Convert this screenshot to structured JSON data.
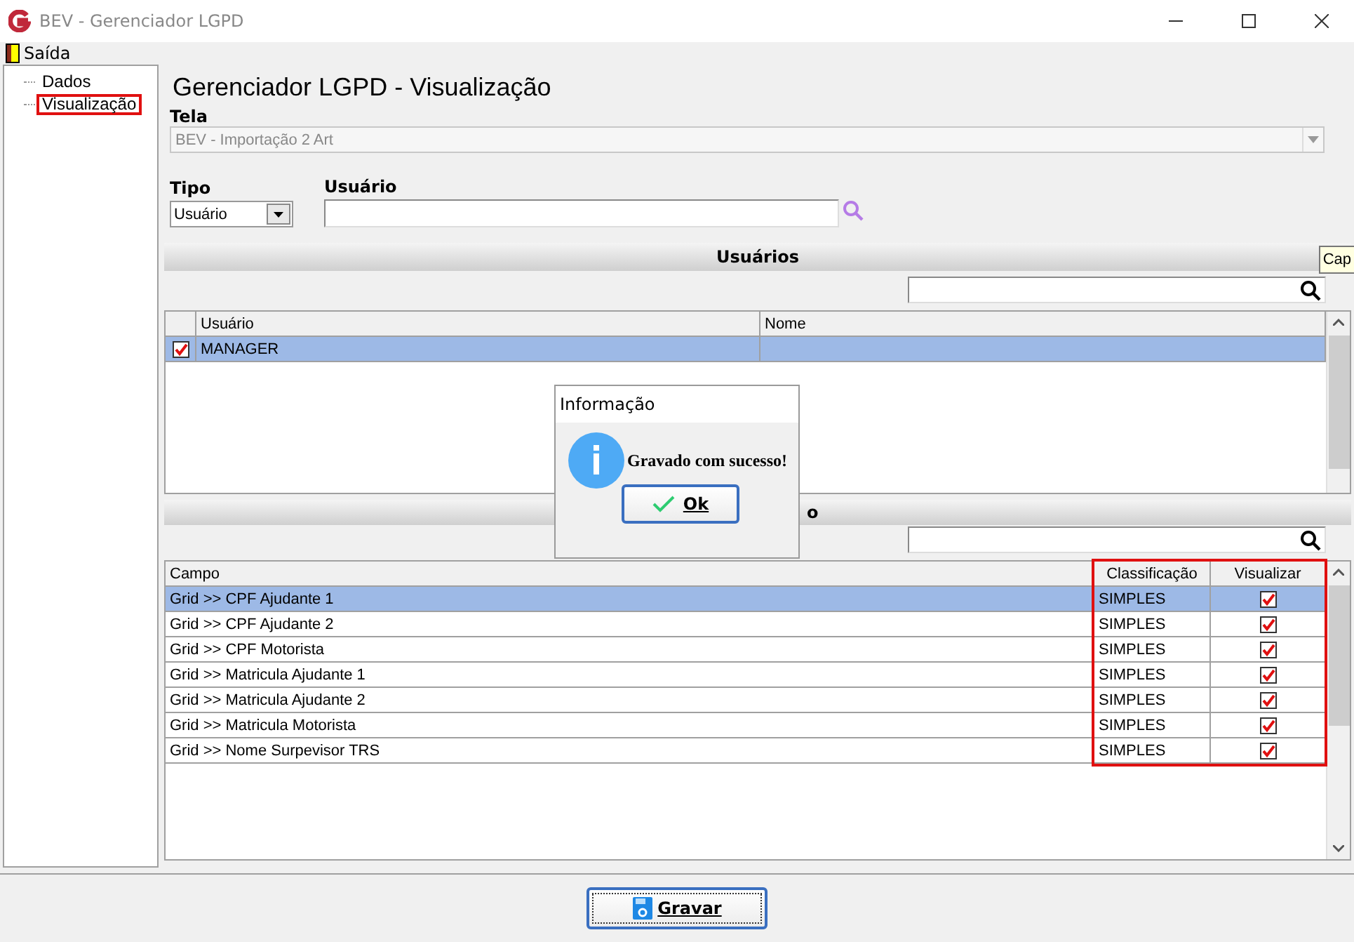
{
  "window": {
    "title": "BEV - Gerenciador LGPD"
  },
  "menu": [
    {
      "label": "Saída"
    }
  ],
  "tree": [
    {
      "label": "Dados",
      "highlighted": false
    },
    {
      "label": "Visualização",
      "highlighted": true
    }
  ],
  "heading": "Gerenciador LGPD - Visualização",
  "tela": {
    "label": "Tela",
    "value": "BEV - Importação 2 Art"
  },
  "tipo": {
    "label": "Tipo",
    "value": "Usuário"
  },
  "usuario": {
    "label": "Usuário"
  },
  "users_section": {
    "title": "Usuários"
  },
  "users_table": {
    "columns": [
      "Usuário",
      "Nome"
    ],
    "rows": [
      {
        "checked": true,
        "selected": true,
        "cells": [
          "MANAGER",
          ""
        ]
      }
    ]
  },
  "fields_section": {
    "title": "o"
  },
  "fields_table": {
    "columns": [
      "Campo",
      "Classificação",
      "Visualizar"
    ],
    "highlight_columns": true,
    "rows": [
      {
        "selected": true,
        "campo": "Grid >> CPF Ajudante 1",
        "classificacao": "SIMPLES",
        "visualizar": true
      },
      {
        "selected": false,
        "campo": "Grid >> CPF Ajudante 2",
        "classificacao": "SIMPLES",
        "visualizar": true
      },
      {
        "selected": false,
        "campo": "Grid >> CPF Motorista",
        "classificacao": "SIMPLES",
        "visualizar": true
      },
      {
        "selected": false,
        "campo": "Grid >> Matricula Ajudante 1",
        "classificacao": "SIMPLES",
        "visualizar": true
      },
      {
        "selected": false,
        "campo": "Grid >> Matricula Ajudante 2",
        "classificacao": "SIMPLES",
        "visualizar": true
      },
      {
        "selected": false,
        "campo": "Grid >> Matricula Motorista",
        "classificacao": "SIMPLES",
        "visualizar": true
      },
      {
        "selected": false,
        "campo": "Grid >> Nome Surpevisor TRS",
        "classificacao": "SIMPLES",
        "visualizar": true
      }
    ]
  },
  "dialog": {
    "title": "Informação",
    "message": "Gravado com sucesso!",
    "button": "Ok"
  },
  "tooltip": "Cap",
  "save_button": "Gravar"
}
